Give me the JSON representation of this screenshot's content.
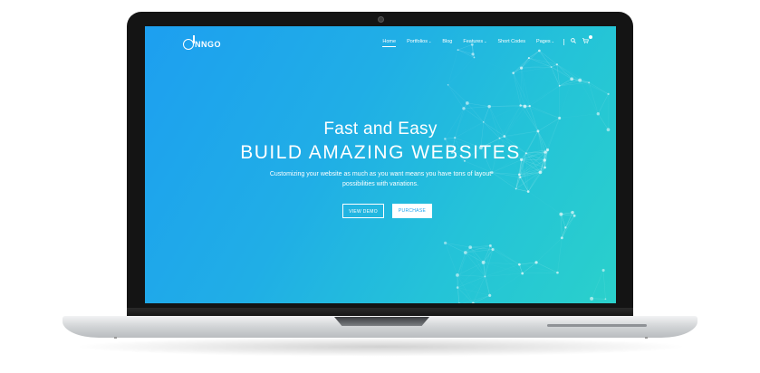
{
  "logo": {
    "text": "NNGO"
  },
  "nav": {
    "items": [
      {
        "label": "Home",
        "active": true,
        "has_caret": false
      },
      {
        "label": "Portfolios",
        "active": false,
        "has_caret": true
      },
      {
        "label": "Blog",
        "active": false,
        "has_caret": false
      },
      {
        "label": "Features",
        "active": false,
        "has_caret": true
      },
      {
        "label": "Short Codes",
        "active": false,
        "has_caret": false
      },
      {
        "label": "Pages",
        "active": false,
        "has_caret": true
      }
    ],
    "caret_glyph": "⌄",
    "search_icon": "search-icon",
    "cart_icon": "cart-icon"
  },
  "hero": {
    "kicker": "Fast and Easy",
    "title": "BUILD AMAZING WEBSITES",
    "description": "Customizing your website as much as you want means you have tons of layout possibilities with variations.",
    "primary_button": "VIEW DEMO",
    "secondary_button": "PURCHASE"
  },
  "colors": {
    "gradient_start": "#1d9ff0",
    "gradient_end": "#2ad0cb",
    "accent": "#1ea3ee"
  }
}
